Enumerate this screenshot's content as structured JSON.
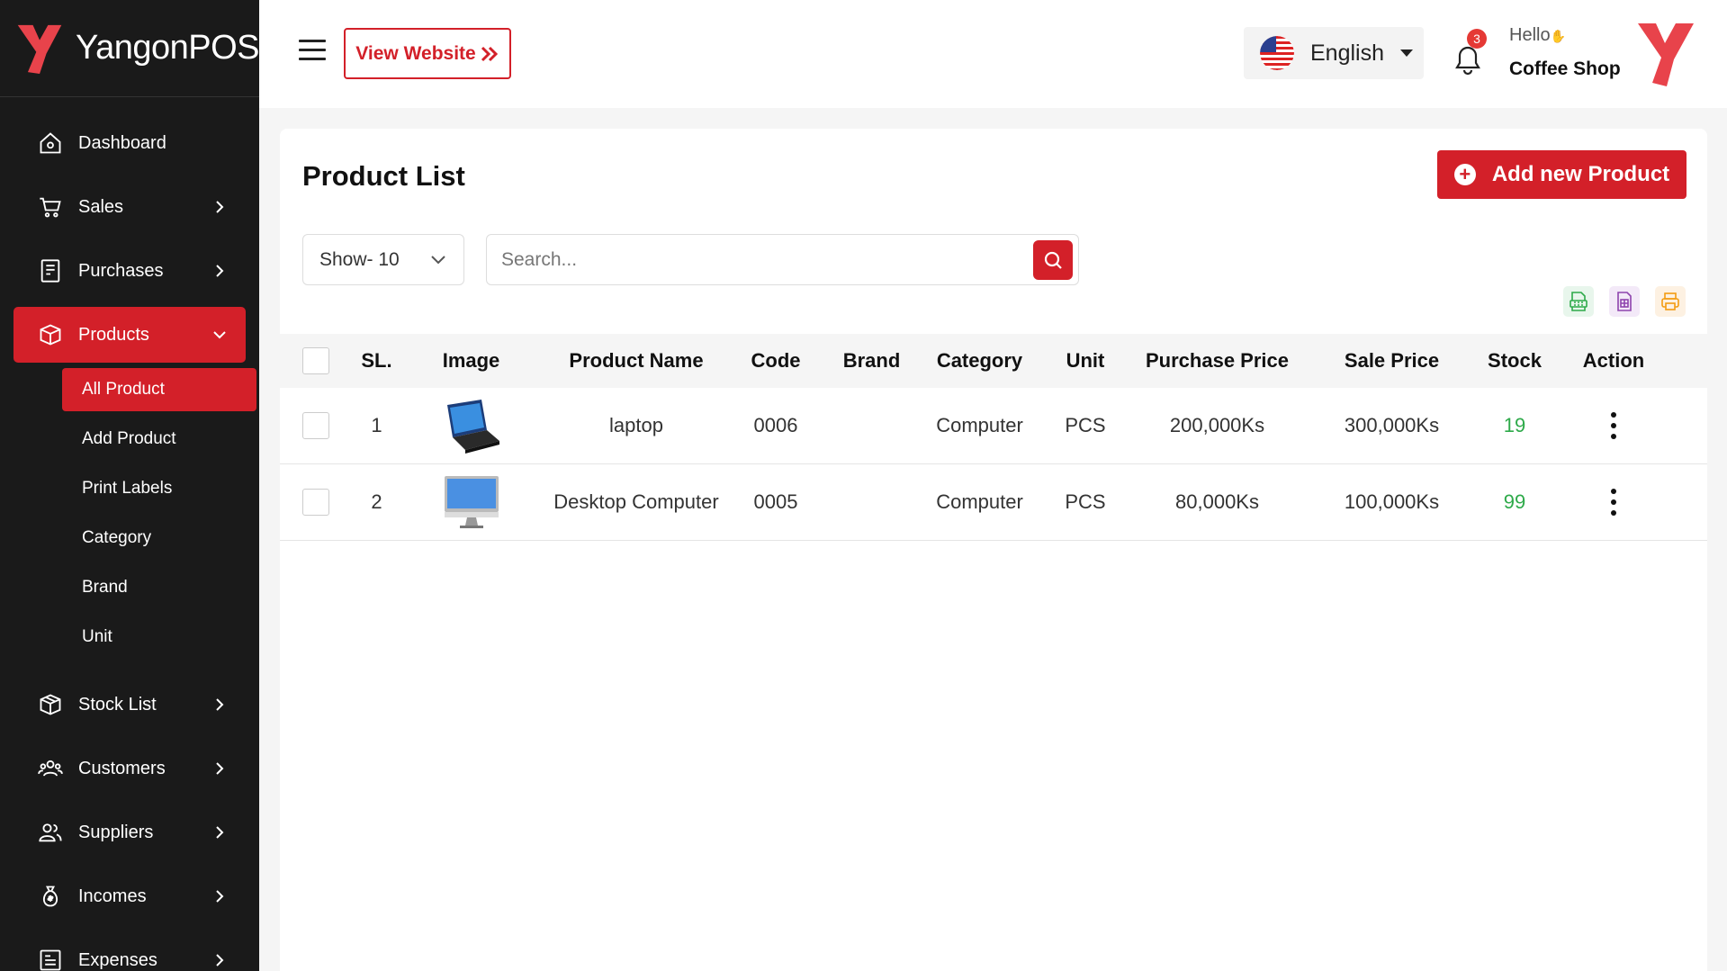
{
  "brand": {
    "name": "YangonPOS",
    "logo_color": "#e8434b"
  },
  "sidebar": {
    "items": [
      {
        "label": "Dashboard",
        "icon": "home-icon"
      },
      {
        "label": "Sales",
        "icon": "cart-icon"
      },
      {
        "label": "Purchases",
        "icon": "receipt-icon"
      },
      {
        "label": "Products",
        "icon": "box-icon",
        "active": true
      },
      {
        "label": "Stock List",
        "icon": "package-icon"
      },
      {
        "label": "Customers",
        "icon": "users-icon"
      },
      {
        "label": "Suppliers",
        "icon": "user-group-icon"
      },
      {
        "label": "Incomes",
        "icon": "money-bag-icon"
      },
      {
        "label": "Expenses",
        "icon": "invoice-icon"
      }
    ],
    "products_sub": [
      {
        "label": "All Product",
        "active": true
      },
      {
        "label": "Add Product"
      },
      {
        "label": "Print Labels"
      },
      {
        "label": "Category"
      },
      {
        "label": "Brand"
      },
      {
        "label": "Unit"
      }
    ]
  },
  "header": {
    "view_website": "View Website",
    "language": "English",
    "notification_count": "3",
    "greeting": "Hello",
    "shop_name": "Coffee Shop"
  },
  "main": {
    "title": "Product List",
    "add_button": "Add new Product",
    "show_select": "Show- 10",
    "search_placeholder": "Search...",
    "export_buttons": [
      {
        "icon": "csv-icon",
        "color": "#2eaa4a"
      },
      {
        "icon": "excel-sheet-icon",
        "color": "#8e44ad"
      },
      {
        "icon": "printer-icon",
        "color": "#f39c12"
      }
    ],
    "table": {
      "headers": [
        "SL.",
        "Image",
        "Product Name",
        "Code",
        "Brand",
        "Category",
        "Unit",
        "Purchase Price",
        "Sale Price",
        "Stock",
        "Action"
      ],
      "rows": [
        {
          "sl": "1",
          "image": "laptop-image",
          "name": "laptop",
          "code": "0006",
          "brand": "",
          "category": "Computer",
          "unit": "PCS",
          "purchase_price": "200,000Ks",
          "sale_price": "300,000Ks",
          "stock": "19"
        },
        {
          "sl": "2",
          "image": "desktop-image",
          "name": "Desktop Computer",
          "code": "0005",
          "brand": "",
          "category": "Computer",
          "unit": "PCS",
          "purchase_price": "80,000Ks",
          "sale_price": "100,000Ks",
          "stock": "99"
        }
      ]
    }
  },
  "colors": {
    "accent": "#d32029",
    "sidebar_bg": "#1a1a1a",
    "stock_green": "#2eaa4a"
  }
}
